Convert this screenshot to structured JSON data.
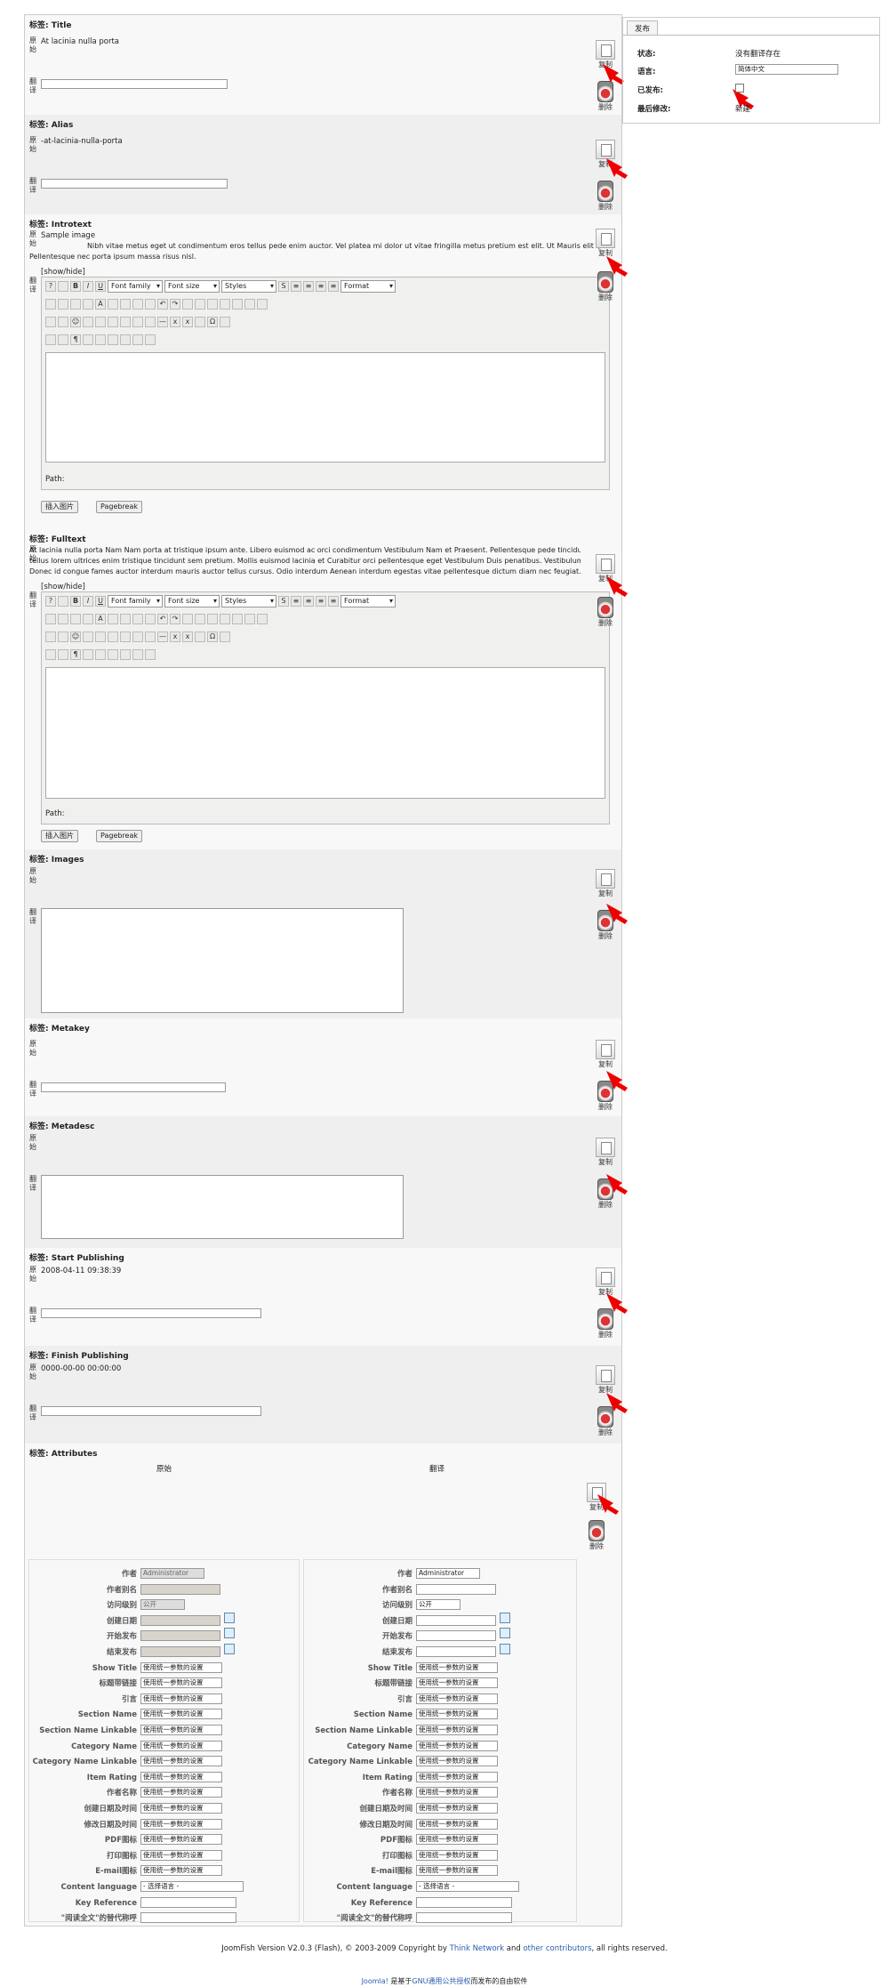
{
  "fields": {
    "title": {
      "label": "标签: Title",
      "source": "At lacinia nulla porta"
    },
    "alias": {
      "label": "标签: Alias",
      "source": "-at-lacinia-nulla-porta"
    },
    "introtext": {
      "label": "标签: Introtext",
      "source_line1": "Sample image",
      "source_line2": "Nibh vitae metus eget ut condimentum eros tellus pede enim auctor. Vel platea mi dolor ut vitae fringilla metus pretium est elit. Ut Mauris elit ipsum",
      "source_line3": "Pellentesque nec porta ipsum massa risus nisl."
    },
    "fulltext": {
      "label": "标签: Fulltext",
      "source_line1": "At lacinia nulla porta Nam Nam porta at tristique ipsum ante. Libero euismod ac orci condimentum Vestibulum Nam et Praesent. Pellentesque pede tincidunt",
      "source_line2": "tellus lorem ultrices enim tristique tincidunt sem pretium. Mollis euismod lacinia et Curabitur orci pellentesque eget Vestibulum Duis penatibus. Vestibulum",
      "source_line3": "Donec id congue fames auctor interdum mauris auctor tellus cursus. Odio interdum Aenean interdum egestas vitae pellentesque dictum diam nec feugiat."
    },
    "images": {
      "label": "标签: Images"
    },
    "metakey": {
      "label": "标签: Metakey"
    },
    "metadesc": {
      "label": "标签: Metadesc"
    },
    "start_publishing": {
      "label": "标签: Start Publishing",
      "source": "2008-04-11 09:38:39"
    },
    "finish_publishing": {
      "label": "标签: Finish Publishing",
      "source": "0000-00-00 00:00:00"
    },
    "attributes": {
      "label": "标签: Attributes",
      "col_original": "原始",
      "col_translation": "翻译"
    }
  },
  "labels": {
    "original": "原始",
    "translation": "翻译",
    "copy": "复制",
    "delete": "删除",
    "show_hide": "[show/hide]",
    "path": "Path:",
    "insert_image": "插入图片",
    "pagebreak": "Pagebreak"
  },
  "editor": {
    "font_family": "Font family",
    "font_size": "Font size",
    "styles": "Styles",
    "format": "Format"
  },
  "attr_labels": [
    "作者",
    "作者别名",
    "访问级别",
    "创建日期",
    "开始发布",
    "结束发布",
    "Show Title",
    "标题带链接",
    "引言",
    "Section Name",
    "Section Name Linkable",
    "Category Name",
    "Category Name Linkable",
    "Item Rating",
    "作者名称",
    "创建日期及时间",
    "修改日期及时间",
    "PDF图标",
    "打印图标",
    "E-mail图标",
    "Content language",
    "Key Reference",
    "\"阅读全文\"的替代称呼"
  ],
  "attr_values": {
    "author": "Administrator",
    "access": "公开",
    "param": "使用统一参数的设置",
    "lang": "- 选择语言 -"
  },
  "sidebar": {
    "tab": "发布",
    "status_label": "状态:",
    "status_value": "没有翻译存在",
    "language_label": "语言:",
    "language_value": "简体中文",
    "published_label": "已发布:",
    "modified_label": "最后修改:",
    "modified_value": "新建"
  },
  "footer": {
    "version_text": "JoomFish Version V2.0.3 (Flash), © 2003-2009 Copyright by",
    "think_network": "Think Network",
    "and": "and",
    "other_contributors": "other contributors",
    "rights": ", all rights reserved.",
    "joomla": "Joomla!",
    "joomla_rest1": " 是基于",
    "gnu": "GNU通用公共授权",
    "joomla_rest2": "而发布的自由软件"
  }
}
